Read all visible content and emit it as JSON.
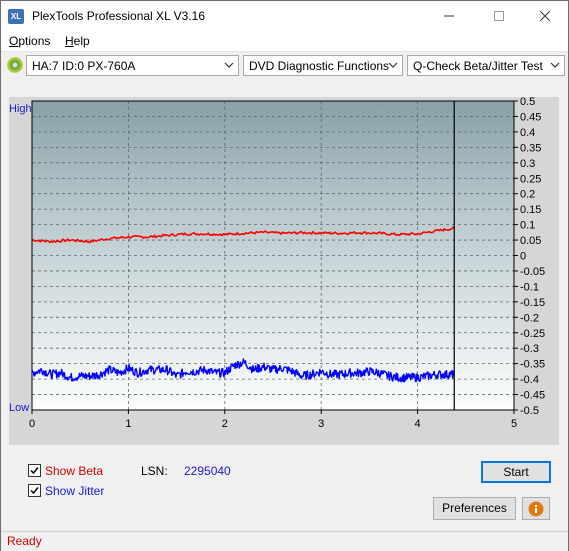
{
  "window": {
    "title": "PlexTools Professional XL V3.16",
    "app_icon_text": "XL",
    "controls": [
      "minimize",
      "maximize",
      "close"
    ]
  },
  "menu": {
    "items": [
      {
        "label": "Options",
        "accel": "O",
        "rest": "ptions"
      },
      {
        "label": "Help",
        "accel": "H",
        "rest": "elp"
      }
    ]
  },
  "toolbar": {
    "drive": "HA:7 ID:0  PX-760A",
    "function": "DVD Diagnostic Functions",
    "test": "Q-Check Beta/Jitter Test"
  },
  "chart_data": {
    "type": "line",
    "x_range": [
      0,
      5
    ],
    "x_ticks": [
      "0",
      "1",
      "2",
      "3",
      "4",
      "5"
    ],
    "y_left_labels": {
      "top": "High",
      "bottom": "Low"
    },
    "y_right_range": [
      -0.5,
      0.5
    ],
    "y_right_ticks": [
      "0.5",
      "0.45",
      "0.4",
      "0.35",
      "0.3",
      "0.25",
      "0.2",
      "0.15",
      "0.1",
      "0.05",
      "0",
      "-0.05",
      "-0.1",
      "-0.15",
      "-0.2",
      "-0.25",
      "-0.3",
      "-0.35",
      "-0.4",
      "-0.45",
      "-0.5"
    ],
    "grid": true,
    "end_marker_x": 4.38,
    "series": [
      {
        "name": "Beta",
        "color": "#ff0000",
        "x": [
          0,
          0.2,
          0.4,
          0.6,
          0.8,
          1.0,
          1.2,
          1.4,
          1.6,
          1.8,
          2.0,
          2.2,
          2.4,
          2.6,
          2.8,
          3.0,
          3.2,
          3.4,
          3.6,
          3.8,
          4.0,
          4.2,
          4.38
        ],
        "y": [
          0.05,
          0.045,
          0.05,
          0.045,
          0.055,
          0.06,
          0.06,
          0.065,
          0.07,
          0.07,
          0.068,
          0.072,
          0.075,
          0.072,
          0.074,
          0.073,
          0.072,
          0.074,
          0.072,
          0.068,
          0.07,
          0.08,
          0.088
        ]
      },
      {
        "name": "Jitter",
        "color": "#0000ff",
        "x": [
          0,
          0.1,
          0.2,
          0.3,
          0.4,
          0.5,
          0.6,
          0.7,
          0.8,
          0.9,
          1.0,
          1.1,
          1.2,
          1.3,
          1.4,
          1.5,
          1.6,
          1.7,
          1.8,
          1.9,
          2.0,
          2.1,
          2.2,
          2.3,
          2.4,
          2.5,
          2.6,
          2.7,
          2.8,
          2.9,
          3.0,
          3.1,
          3.2,
          3.3,
          3.4,
          3.5,
          3.6,
          3.7,
          3.8,
          3.9,
          4.0,
          4.1,
          4.2,
          4.3,
          4.38
        ],
        "y": [
          -0.38,
          -0.37,
          -0.385,
          -0.38,
          -0.395,
          -0.39,
          -0.39,
          -0.385,
          -0.37,
          -0.38,
          -0.365,
          -0.38,
          -0.37,
          -0.37,
          -0.37,
          -0.39,
          -0.375,
          -0.375,
          -0.37,
          -0.38,
          -0.38,
          -0.355,
          -0.345,
          -0.37,
          -0.36,
          -0.37,
          -0.365,
          -0.375,
          -0.39,
          -0.385,
          -0.375,
          -0.385,
          -0.385,
          -0.38,
          -0.38,
          -0.375,
          -0.38,
          -0.39,
          -0.395,
          -0.395,
          -0.395,
          -0.39,
          -0.385,
          -0.385,
          -0.385
        ]
      }
    ]
  },
  "options": {
    "show_beta": {
      "label": "Show Beta",
      "checked": true
    },
    "show_jitter": {
      "label": "Show Jitter",
      "checked": true
    }
  },
  "lsn": {
    "label": "LSN:",
    "value": "2295040"
  },
  "buttons": {
    "start": "Start",
    "preferences": "Preferences"
  },
  "status": {
    "text": "Ready"
  }
}
